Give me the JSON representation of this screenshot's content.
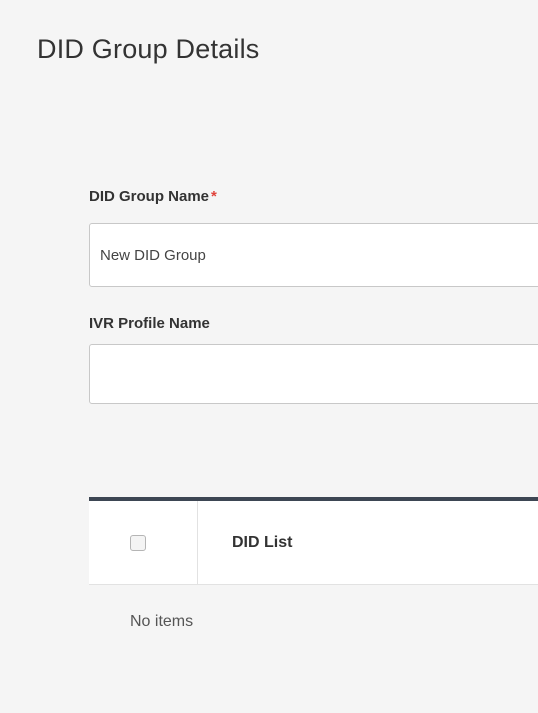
{
  "page": {
    "title": "DID Group Details"
  },
  "form": {
    "group_name": {
      "label": "DID Group Name",
      "required_mark": "*",
      "value": "New DID Group"
    },
    "ivr_profile": {
      "label": "IVR Profile Name",
      "value": ""
    }
  },
  "table": {
    "columns": [
      "DID List"
    ],
    "empty_message": "No items"
  }
}
